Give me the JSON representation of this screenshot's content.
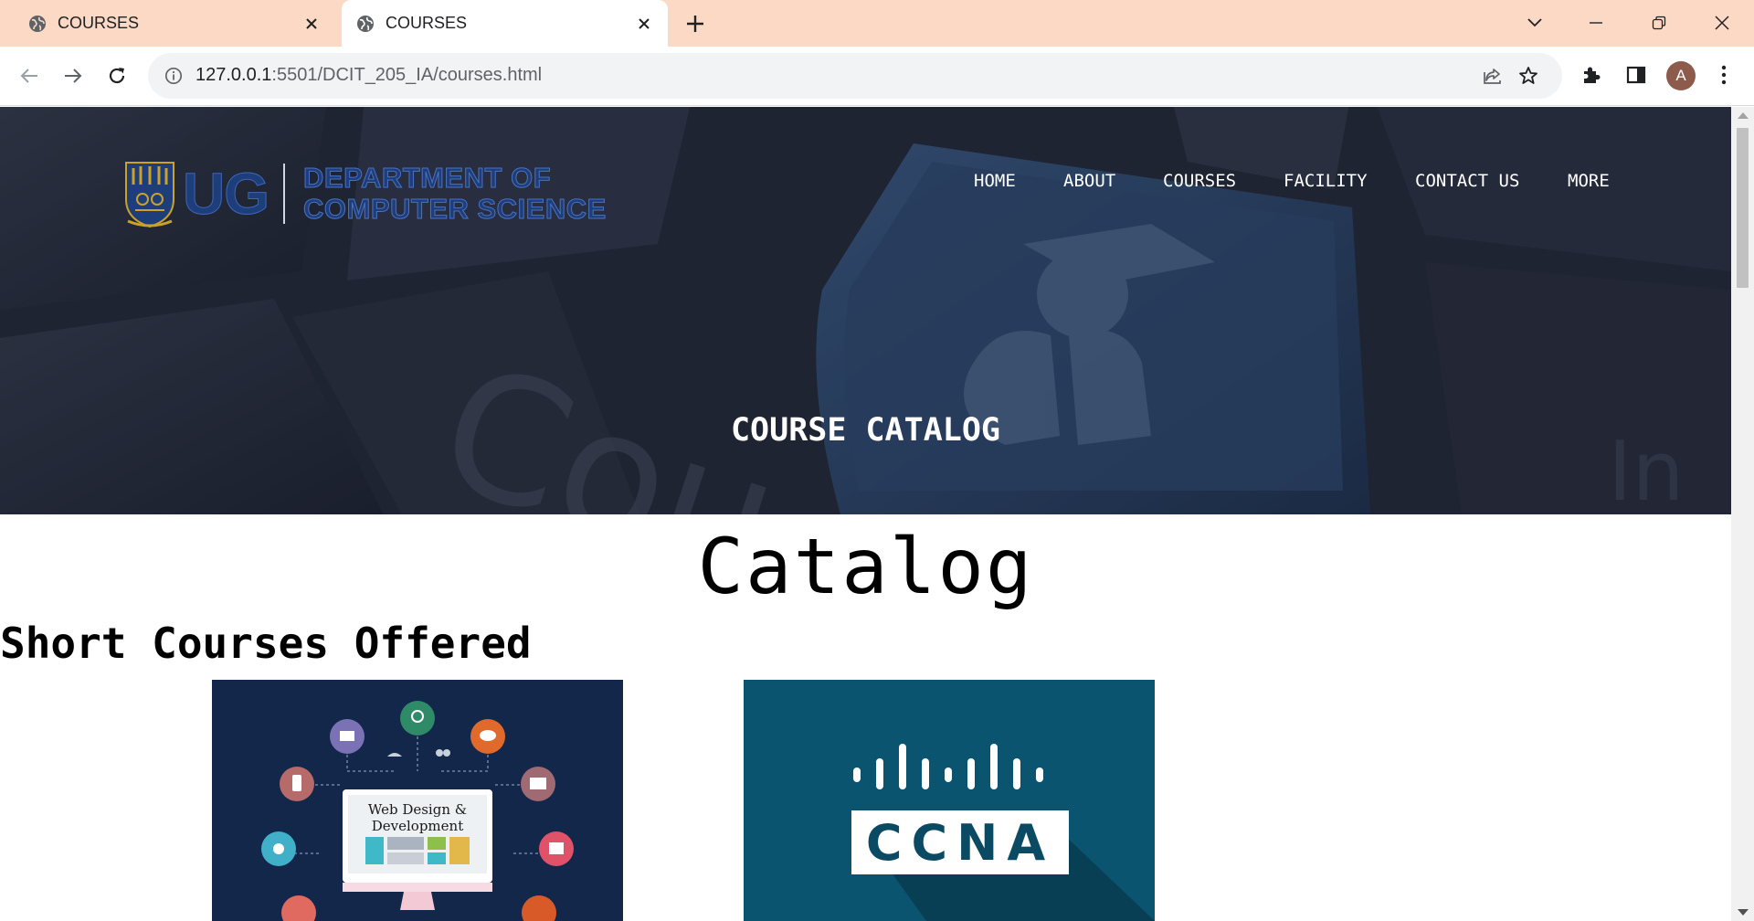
{
  "browser": {
    "tabs": [
      {
        "title": "COURSES",
        "active": false
      },
      {
        "title": "COURSES",
        "active": true
      }
    ],
    "url": {
      "host": "127.0.0.1",
      "port_path": ":5501/DCIT_205_IA/courses.html"
    },
    "profile_initial": "A",
    "colors": {
      "tabbar": "#fcd9c4",
      "omnibox": "#f1f3f4"
    }
  },
  "site": {
    "logo": {
      "ug": "UG",
      "dept_line1": "DEPARTMENT OF",
      "dept_line2": "COMPUTER SCIENCE"
    },
    "nav": [
      "HOME",
      "ABOUT",
      "COURSES",
      "FACILITY",
      "CONTACT US",
      "MORE"
    ],
    "hero_title": "COURSE CATALOG",
    "catalog_title": "Catalog",
    "section_title": "Short Courses Offered",
    "courses": [
      {
        "image_text_line1": "Web Design &",
        "image_text_line2": "Development",
        "background": "#12274a"
      },
      {
        "image_text": "CCNA",
        "background": "#0b5470"
      }
    ]
  }
}
